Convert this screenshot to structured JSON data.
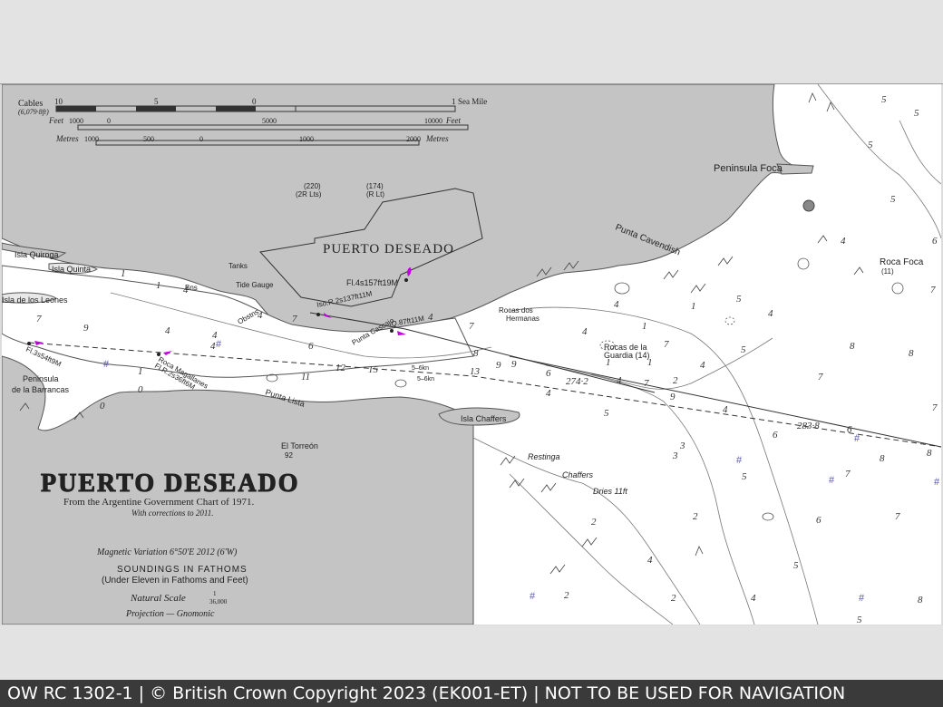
{
  "chart": {
    "scale_bar": {
      "cables_label": "Cables",
      "cables_note": "(6,079·8ft)",
      "cables_ticks": [
        "10",
        "5",
        "0",
        "1"
      ],
      "sea_mile_label": "Sea Mile",
      "feet_label": "Feet",
      "feet_ticks": [
        "1000",
        "0",
        "5000",
        "10000"
      ],
      "feet_end_label": "Feet",
      "metres_label": "Metres",
      "metres_ticks": [
        "1000",
        "500",
        "0",
        "1000",
        "2000"
      ],
      "metres_end_label": "Metres"
    },
    "title_block": {
      "title": "PUERTO DESEADO",
      "source": "From the Argentine Government Chart of 1971.",
      "corrections": "With corrections to 2011.",
      "magnetic_variation": "Magnetic Variation 6°50'E 2012 (6'W)",
      "soundings": "SOUNDINGS IN FATHOMS",
      "soundings_note": "(Under Eleven in Fathoms and Feet)",
      "natural_scale_label": "Natural Scale",
      "scale_num": "1",
      "scale_den": "36,000",
      "projection": "Projection — Gnomonic"
    },
    "places": {
      "town": "PUERTO DESEADO",
      "peninsula_foca": "Peninsula Foca",
      "punta_cavendish": "Punta Cavendish",
      "roca_foca": "Roca Foca",
      "roca_foca_depth": "(11)",
      "isla_quiroga": "Isla Quiroga",
      "isla_quinta": "Isla Quinta",
      "isla_leones": "Isla de los Leones",
      "peninsula_barrancas_1": "Peninsula",
      "peninsula_barrancas_2": "de la Barrancas",
      "isla_chaffers": "Isla Chaffers",
      "el_torreon": "El Torreón",
      "el_torreon_height": "92",
      "punta_lista": "Punta Lista",
      "punta_cascajo": "Punta Cascajo",
      "rocas_hermanas_1": "Rocas dos",
      "rocas_hermanas_2": "Hermanas",
      "rocas_guardia_1": "Rocas de la",
      "rocas_guardia_2": "Guardia (14)",
      "restinga": "Restinga",
      "chaffers": "Chaffers",
      "dries": "Dries 11ft",
      "tanks": "Tanks",
      "tide_gauge": "Tide Gauge",
      "bns": "Bns",
      "obstns": "Obstns",
      "roca_magallanes": "Roca Magallanes"
    },
    "lights": {
      "lt_main": "Fl.4s157ft19M",
      "lt_iso": "Iso.R.2s137ft11M",
      "lt_q": "Q.87ft11M",
      "lt_barrancas": "Fl.3s54ft9M",
      "lt_magallanes": "Fl.R.2s36ft6M",
      "lt_220": "(220)",
      "lt_220b": "(2R Lts)",
      "lt_174": "(174)",
      "lt_174b": "(R Lt)",
      "brg_274": "274·2",
      "brg_2838": "283·8",
      "kn_1": "5–6kn",
      "kn_2": "5–6kn"
    }
  },
  "footer": {
    "text": "OW RC 1302-1 | © British Crown Copyright 2023 (EK001-ET) | NOT TO BE USED FOR NAVIGATION"
  }
}
